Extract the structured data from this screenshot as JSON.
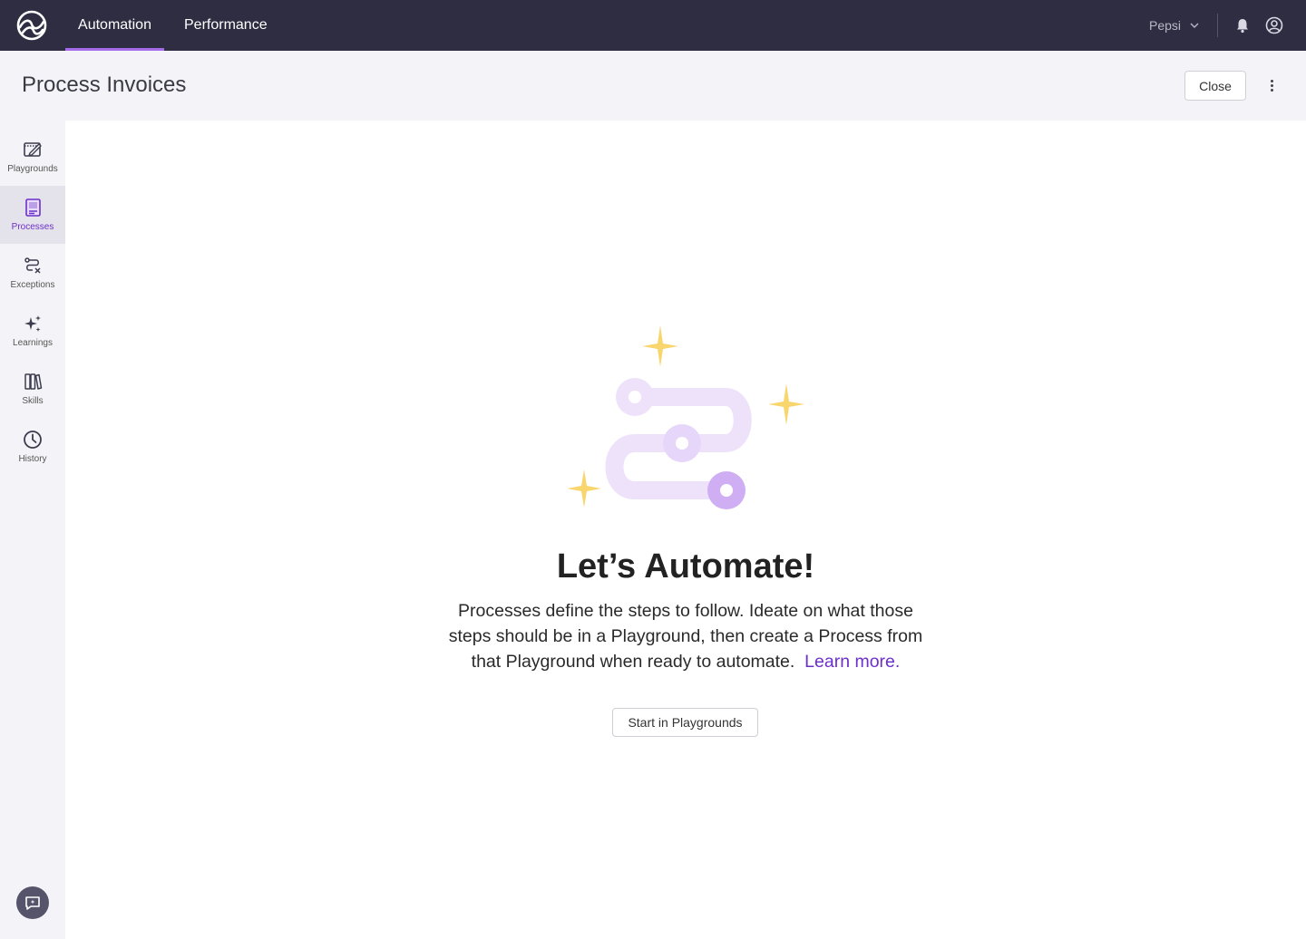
{
  "topbar": {
    "tabs": [
      {
        "label": "Automation",
        "active": true
      },
      {
        "label": "Performance",
        "active": false
      }
    ],
    "org": "Pepsi",
    "accent": "#a56bea",
    "background": "#2e2d42"
  },
  "header": {
    "title": "Process Invoices",
    "close_label": "Close"
  },
  "sidebar": {
    "items": [
      {
        "label": "Playgrounds",
        "icon": "playground-icon"
      },
      {
        "label": "Processes",
        "icon": "processes-icon",
        "active": true
      },
      {
        "label": "Exceptions",
        "icon": "exceptions-icon"
      },
      {
        "label": "Learnings",
        "icon": "sparkle-icon"
      },
      {
        "label": "Skills",
        "icon": "books-icon"
      },
      {
        "label": "History",
        "icon": "clock-icon"
      }
    ],
    "active_color": "#6d2fc9"
  },
  "empty_state": {
    "headline": "Let’s Automate!",
    "description": "Processes define the steps to follow. Ideate on what those steps should be in a Playground, then create a Process from that Playground when ready to automate.",
    "learn_more": "Learn more.",
    "cta_label": "Start in Playgrounds",
    "sparkle_color": "#f9d56e",
    "path_color": "#eee2fb"
  }
}
